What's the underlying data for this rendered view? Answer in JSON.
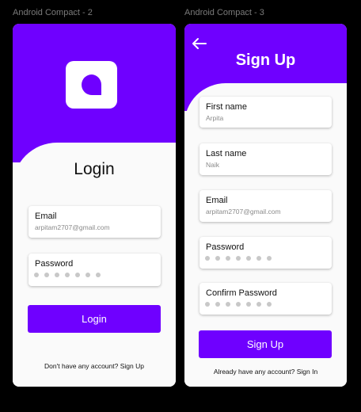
{
  "frames": {
    "login_label": "Android Compact - 2",
    "signup_label": "Android Compact - 3"
  },
  "login": {
    "title": "Login",
    "email_label": "Email",
    "email_value": "arpitam2707@gmail.com",
    "password_label": "Password",
    "password_dots": 7,
    "button_label": "Login",
    "footer": "Don't have any account? Sign Up"
  },
  "signup": {
    "title": "Sign Up",
    "back_icon": "arrow-left-icon",
    "first_name_label": "First name",
    "first_name_value": "Arpita",
    "last_name_label": "Last name",
    "last_name_value": "Naik",
    "email_label": "Email",
    "email_value": "arpitam2707@gmail.com",
    "password_label": "Password",
    "password_dots": 7,
    "confirm_password_label": "Confirm Password",
    "confirm_password_dots": 7,
    "button_label": "Sign Up",
    "footer": "Already have any account? Sign In"
  },
  "colors": {
    "accent": "#6f00ff",
    "background": "#000000",
    "card": "#fafafa"
  }
}
